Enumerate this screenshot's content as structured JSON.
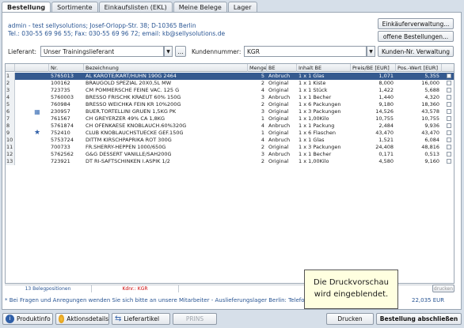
{
  "tabs": [
    "Bestellung",
    "Sortimente",
    "Einkaufslisten (EKL)",
    "Meine Belege",
    "Lager"
  ],
  "header": {
    "line1": "admin - test sellysolutions; Josef-Orlopp-Str. 38; D-10365 Berlin",
    "line2": "Tel.: 030-55 69 96 55; Fax: 030-55 69 96 72; email: kb@sellysolutions.de"
  },
  "buttons": {
    "einkaeufer": "Einkäuferverwaltung...",
    "offene": "offene Bestellungen...",
    "dots": "...",
    "kundennr": "Kunden-Nr. Verwaltung",
    "drucken": "Drucken",
    "abschliessen": "Bestellung abschließen",
    "produktinfo": "Produktinfo",
    "aktionsdetails": "Aktionsdetails",
    "lieferartikel": "Lieferartikel",
    "prins": "PRINS",
    "print_small": "drucken"
  },
  "form": {
    "lieferant_label": "Lieferant:",
    "lieferant_value": "Unser Trainingslieferant",
    "kundennummer_label": "Kundennummer:",
    "kundennummer_value": "KGR"
  },
  "columns": [
    "Nr.",
    "Bezeichnung",
    "Menge",
    "BE",
    "Inhalt BE",
    "Preis/BE [EUR]",
    "Pos.-Wert [EUR]"
  ],
  "rows": [
    {
      "n": "1",
      "icon": "",
      "nr": "5765013",
      "bez": "AL KAROTE/KART/HUHN 190G 2464",
      "menge": "5",
      "be": "Anbruch",
      "inhalt": "1 x 1 Glas",
      "preis": "1,071",
      "wert": "5,355"
    },
    {
      "n": "2",
      "icon": "",
      "nr": "100162",
      "bez": "BRAUGOLD SPEZIAL 20X0,5L MW",
      "menge": "2",
      "be": "Original",
      "inhalt": "1 x 1 Kiste",
      "preis": "8,000",
      "wert": "16,000"
    },
    {
      "n": "3",
      "icon": "",
      "nr": "723735",
      "bez": "CM POMMERSCHE FEINE VAC. 125 G",
      "menge": "4",
      "be": "Original",
      "inhalt": "1 x 1 Stück",
      "preis": "1,422",
      "wert": "5,688"
    },
    {
      "n": "4",
      "icon": "",
      "nr": "5760003",
      "bez": "BRESSO FRISCHK KRAEUT 60% 150G",
      "menge": "3",
      "be": "Anbruch",
      "inhalt": "1 x 1 Becher",
      "preis": "1,440",
      "wert": "4,320"
    },
    {
      "n": "5",
      "icon": "",
      "nr": "760984",
      "bez": "BRESSO WEICHKA FEIN KR 10%200G",
      "menge": "2",
      "be": "Original",
      "inhalt": "1 x 6 Packungen",
      "preis": "9,180",
      "wert": "18,360"
    },
    {
      "n": "6",
      "icon": "calendar-icon",
      "nr": "230957",
      "bez": "BUER.TORTELLINI GRUEN 1,5KG PK",
      "menge": "3",
      "be": "Original",
      "inhalt": "1 x 3 Packungen",
      "preis": "14,526",
      "wert": "43,578"
    },
    {
      "n": "7",
      "icon": "",
      "nr": "761567",
      "bez": "CH GREYERZER 49% CA 1,8KG",
      "menge": "1",
      "be": "Original",
      "inhalt": "1 x 1,00Kilo",
      "preis": "10,755",
      "wert": "10,755"
    },
    {
      "n": "8",
      "icon": "",
      "nr": "5761874",
      "bez": "CH OFENKAESE KNOBLAUCH.60%320G",
      "menge": "4",
      "be": "Anbruch",
      "inhalt": "1 x 1 Packung",
      "preis": "2,484",
      "wert": "9,936"
    },
    {
      "n": "9",
      "icon": "star-icon",
      "nr": "752410",
      "bez": "CLUB KNOBLAUCHSTUECKE GEF.150G",
      "menge": "1",
      "be": "Original",
      "inhalt": "1 x 6 Flaschen",
      "preis": "43,470",
      "wert": "43,470"
    },
    {
      "n": "10",
      "icon": "",
      "nr": "5753724",
      "bez": "DITTM KIRSCHPAPRIKA ROT 300G",
      "menge": "4",
      "be": "Anbruch",
      "inhalt": "1 x 1 Glas",
      "preis": "1,521",
      "wert": "6,084"
    },
    {
      "n": "11",
      "icon": "",
      "nr": "700733",
      "bez": "FR.SHERRY-HEPPEN 1000/650G",
      "menge": "2",
      "be": "Original",
      "inhalt": "1 x 3 Packungen",
      "preis": "24,408",
      "wert": "48,816"
    },
    {
      "n": "12",
      "icon": "",
      "nr": "5762562",
      "bez": "G&G DESSERT VANILLE/SAH200G",
      "menge": "3",
      "be": "Anbruch",
      "inhalt": "1 x 1 Becher",
      "preis": "0,171",
      "wert": "0,513"
    },
    {
      "n": "13",
      "icon": "",
      "nr": "723921",
      "bez": "DT RI-SAFTSCHINKEN I.ASPIK 1/2",
      "menge": "2",
      "be": "Original",
      "inhalt": "1 x 1,00Kilo",
      "preis": "4,580",
      "wert": "9,160"
    }
  ],
  "status": {
    "positions": "13 Belegpositionen",
    "kdnr": "Kdnr.: KGR"
  },
  "footer_note": "* Bei Fragen und Anregungen wenden Sie sich bitte an unsere Mitarbeiter - Auslieferungslager Berlin: Telefon 12",
  "total_fragment": "22,035 EUR",
  "tooltip": "Die Druckvorschau wird eingeblendet.",
  "colors": {
    "selected_row": "#355a8f",
    "link_text": "#2a5694",
    "kdnr_red": "#cc0000"
  }
}
